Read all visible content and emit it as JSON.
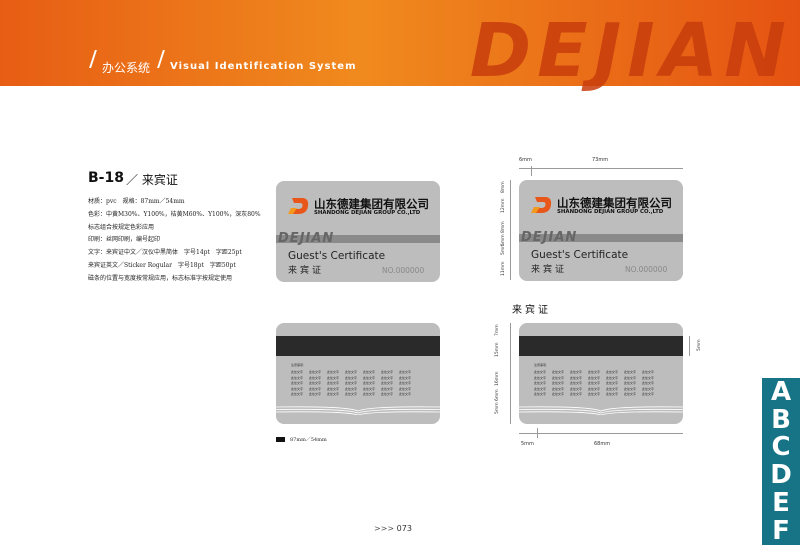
{
  "header": {
    "section_cn": "办公系统",
    "section_en": "Visual Identification System",
    "watermark": "DEJIAN",
    "colors": {
      "start": "#e75d14",
      "end": "#e55312",
      "watermark": "#c83d0c"
    }
  },
  "item": {
    "code": "B-18",
    "title": "／ 来宾证",
    "specs": [
      "材质：pvc　规格：87mm／54mm",
      "色彩：中黄M30%、Y100%，桔黄M60%、Y100%，深灰80%",
      "标志组合按规定色彩应用",
      "印刷：丝网印刷，编号起印",
      "文字：来宾证中文／汉仪中黑简体　字号14pt　字距25pt",
      "来宾证英文／Sticker Rogular　字号18pt　字距50pt",
      "磁条的位置与宽度按常规应用，标志标准字按规定使用"
    ]
  },
  "card": {
    "company_cn": "山东德建集团有限公司",
    "company_en": "SHANDONG DEJIAN GROUP CO.,LTD",
    "brand": "DEJIAN",
    "guest_en": "Guest's Certificate",
    "guest_cn": "来宾证",
    "number": "NO.000000",
    "notes_title": "注意事项:",
    "notes_cell": "此处文字",
    "colors": {
      "body": "#bdbdbd",
      "stripe": "#8a8a8a",
      "logo": "#e8561a",
      "mag": "#2a2a2a"
    }
  },
  "caption": "来宾证",
  "legend": "87mm／54mm",
  "dims": {
    "top_left": "6mm",
    "top_width": "73mm",
    "v_labels": [
      "8mm",
      "12mm",
      "5mm 8mm",
      "5mm",
      "11mm"
    ],
    "back_v": [
      "7mm",
      "15mm",
      "16mm",
      "5mm 6mm"
    ],
    "back_right": "5mm",
    "bottom_left": "5mm",
    "bottom_width": "68mm"
  },
  "page_number": "073",
  "pager_arrows": ">>>",
  "side_tabs": [
    "A",
    "B",
    "C",
    "D",
    "E",
    "F"
  ]
}
